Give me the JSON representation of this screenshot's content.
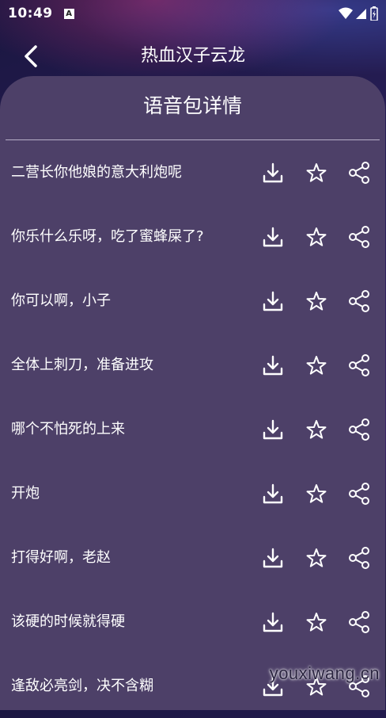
{
  "status": {
    "time": "10:49",
    "notification_badge": "A"
  },
  "header": {
    "title": "热血汉子云龙",
    "back_icon": "chevron-left-icon"
  },
  "panel": {
    "title": "语音包详情"
  },
  "items": [
    {
      "label": "二营长你他娘的意大利炮呢"
    },
    {
      "label": "你乐什么乐呀，吃了蜜蜂屎了?"
    },
    {
      "label": "你可以啊，小子"
    },
    {
      "label": "全体上刺刀，准备进攻"
    },
    {
      "label": "哪个不怕死的上来"
    },
    {
      "label": "开炮"
    },
    {
      "label": "打得好啊，老赵"
    },
    {
      "label": "该硬的时候就得硬"
    },
    {
      "label": "逢敌必亮剑，决不含糊"
    }
  ],
  "icons": {
    "download": "download-icon",
    "favorite": "star-icon",
    "share": "share-icon"
  },
  "watermark": "youxiwang.cn",
  "colors": {
    "panel": "#4d4068",
    "text": "#ffffff"
  }
}
